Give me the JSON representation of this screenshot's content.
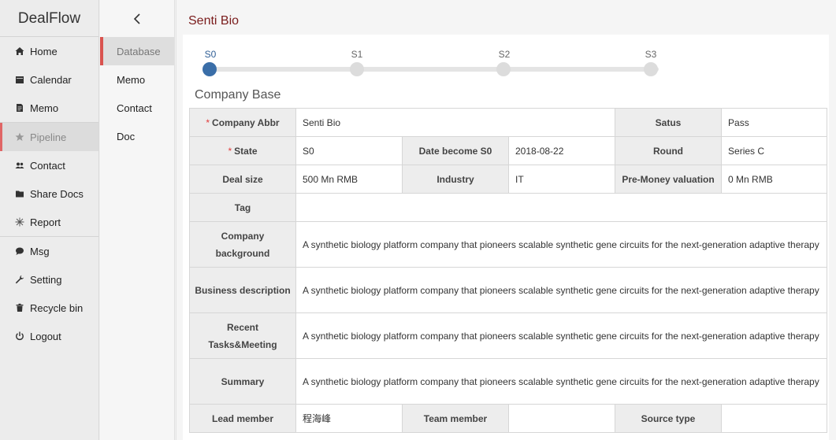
{
  "brand": "DealFlow",
  "nav": {
    "group1": [
      {
        "label": "Home",
        "icon": "home-icon"
      },
      {
        "label": "Calendar",
        "icon": "calendar-icon"
      },
      {
        "label": "Memo",
        "icon": "memo-icon"
      }
    ],
    "group2": [
      {
        "label": "Pipeline",
        "icon": "star-icon",
        "active": true
      },
      {
        "label": "Contact",
        "icon": "contact-icon"
      },
      {
        "label": "Share Docs",
        "icon": "folder-icon"
      },
      {
        "label": "Report",
        "icon": "report-icon"
      }
    ],
    "group3": [
      {
        "label": "Msg",
        "icon": "chat-icon"
      },
      {
        "label": "Setting",
        "icon": "wrench-icon"
      },
      {
        "label": "Recycle bin",
        "icon": "trash-icon"
      },
      {
        "label": "Logout",
        "icon": "power-icon"
      }
    ]
  },
  "subnav": [
    {
      "label": "Database",
      "active": true
    },
    {
      "label": "Memo"
    },
    {
      "label": "Contact"
    },
    {
      "label": "Doc"
    }
  ],
  "page_title": "Senti Bio",
  "stepper": {
    "steps": [
      "S0",
      "S1",
      "S2",
      "S3"
    ],
    "current": "S0"
  },
  "section_title": "Company Base",
  "company": {
    "labels": {
      "company_abbr": "Company Abbr",
      "satus": "Satus",
      "state": "State",
      "date_become_s0": "Date become S0",
      "round": "Round",
      "deal_size": "Deal size",
      "industry": "Industry",
      "pre_money": "Pre-Money valuation",
      "tag": "Tag",
      "company_background": "Company background",
      "business_description": "Business description",
      "recent_tasks": "Recent Tasks&Meeting",
      "summary": "Summary",
      "lead_member": "Lead member",
      "team_member": "Team member",
      "source_type": "Source type"
    },
    "values": {
      "company_abbr": "Senti Bio",
      "satus": "Pass",
      "state": "S0",
      "date_become_s0": "2018-08-22",
      "round": "Series C",
      "deal_size": "500 Mn RMB",
      "industry": "IT",
      "pre_money": "0 Mn RMB",
      "tag": "",
      "company_background": "A synthetic biology platform company that pioneers scalable synthetic gene circuits for the next-generation adaptive therapy",
      "business_description": "A synthetic biology platform company that pioneers scalable synthetic gene circuits for the next-generation adaptive therapy",
      "recent_tasks": "A synthetic biology platform company that pioneers scalable synthetic gene circuits for the next-generation adaptive therapy",
      "summary": "A synthetic biology platform company that pioneers scalable synthetic gene circuits for the next-generation adaptive therapy",
      "lead_member": "程海峰",
      "team_member": "",
      "source_type": ""
    },
    "required_mark": "*"
  },
  "colors": {
    "accent_red": "#e06666",
    "step_active": "#3a6ea8",
    "title_red": "#7a1c1c"
  }
}
